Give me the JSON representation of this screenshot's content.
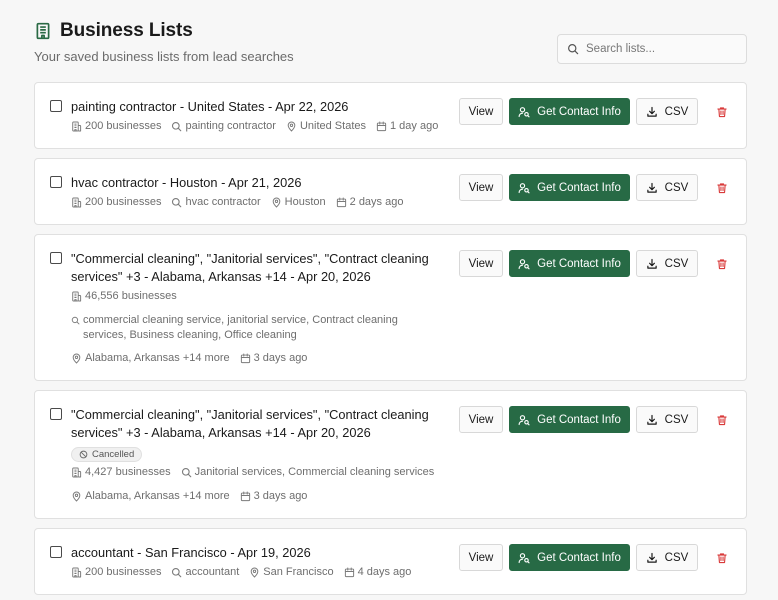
{
  "header": {
    "title": "Business Lists",
    "subtitle": "Your saved business lists from lead searches"
  },
  "search": {
    "placeholder": "Search lists..."
  },
  "actions": {
    "view_label": "View",
    "contact_label": "Get Contact Info",
    "csv_label": "CSV"
  },
  "lists": [
    {
      "name": "painting contractor - United States - Apr 22, 2026",
      "count": "200 businesses",
      "keyword": "painting contractor",
      "location": "United States",
      "age": "1 day ago"
    },
    {
      "name": "hvac contractor - Houston - Apr 21, 2026",
      "count": "200 businesses",
      "keyword": "hvac contractor",
      "location": "Houston",
      "age": "2 days ago"
    },
    {
      "name": "\"Commercial cleaning\", \"Janitorial services\", \"Contract cleaning services\" +3 - Alabama, Arkansas +14 - Apr 20, 2026",
      "count": "46,556 businesses",
      "keyword": "commercial cleaning service, janitorial service, Contract cleaning services, Business cleaning, Office cleaning",
      "location": "Alabama, Arkansas +14 more",
      "age": "3 days ago"
    },
    {
      "name": "\"Commercial cleaning\", \"Janitorial services\", \"Contract cleaning services\" +3 - Alabama, Arkansas +14 - Apr 20, 2026",
      "status": "Cancelled",
      "count": "4,427 businesses",
      "keyword": "Janitorial services, Commercial cleaning services",
      "location": "Alabama, Arkansas +14 more",
      "age": "3 days ago"
    },
    {
      "name": "accountant - San Francisco - Apr 19, 2026",
      "count": "200 businesses",
      "keyword": "accountant",
      "location": "San Francisco",
      "age": "4 days ago"
    }
  ]
}
